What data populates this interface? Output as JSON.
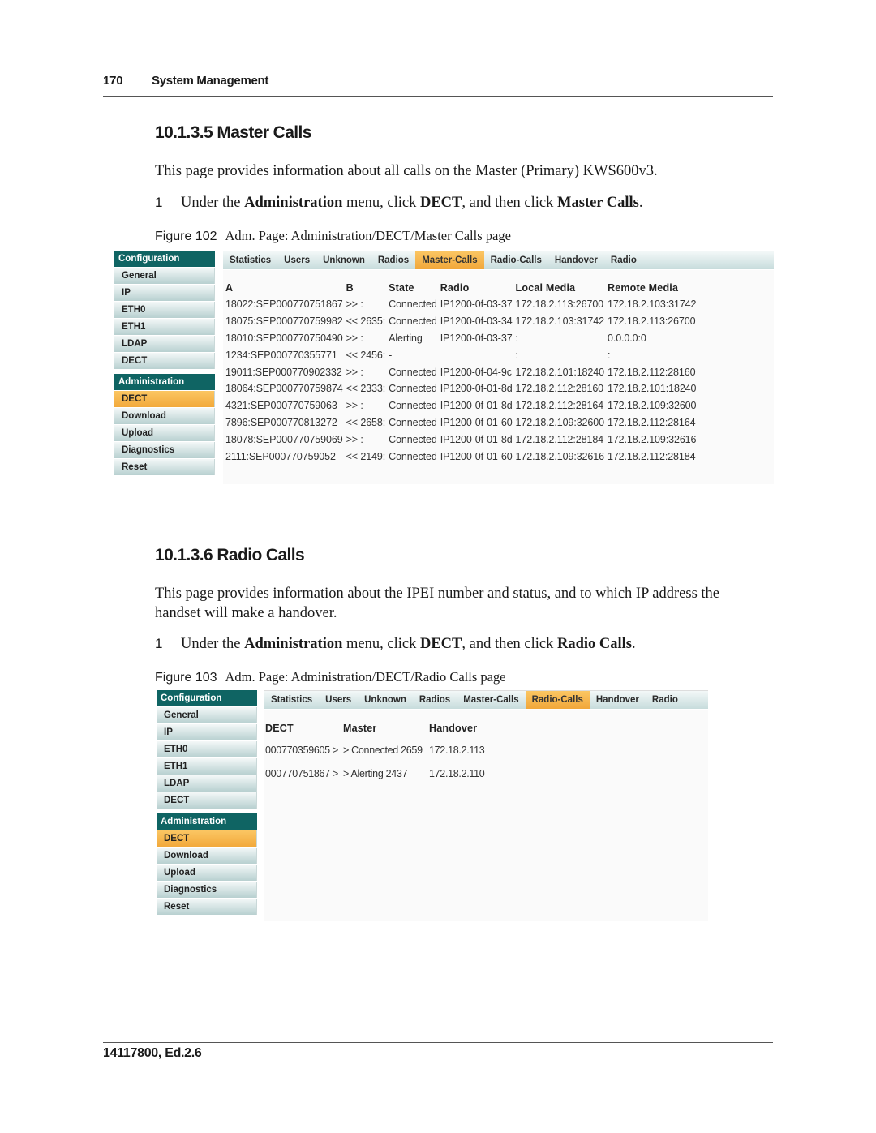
{
  "header": {
    "page_number": "170",
    "section_title": "System Management"
  },
  "footer": {
    "doc_id": "14117800, Ed.2.6"
  },
  "sections": [
    {
      "heading": "10.1.3.5  Master Calls",
      "intro": "This page provides information about all calls on the Master (Primary) KWS600v3.",
      "step": {
        "number": "1",
        "pre": "Under the ",
        "b1": "Administration",
        "mid1": " menu, click ",
        "b2": "DECT",
        "mid2": ", and then click ",
        "b3": "Master Calls",
        "post": "."
      },
      "figure": {
        "label": "Figure 102",
        "caption": "Adm. Page: Administration/DECT/Master Calls page"
      }
    },
    {
      "heading": "10.1.3.6  Radio Calls",
      "intro": "This page provides information about the IPEI number and status, and to which IP address the handset will make a handover.",
      "step": {
        "number": "1",
        "pre": "Under the ",
        "b1": "Administration",
        "mid1": " menu, click ",
        "b2": "DECT",
        "mid2": ", and then click ",
        "b3": "Radio Calls",
        "post": "."
      },
      "figure": {
        "label": "Figure 103",
        "caption": "Adm. Page: Administration/DECT/Radio Calls page"
      }
    }
  ],
  "sidebar": {
    "config_header": "Configuration",
    "config_items": [
      "General",
      "IP",
      "ETH0",
      "ETH1",
      "LDAP",
      "DECT"
    ],
    "admin_header": "Administration",
    "admin_items": [
      "DECT",
      "Download",
      "Upload",
      "Diagnostics",
      "Reset"
    ],
    "active_admin_item": "DECT"
  },
  "tabs": [
    "Statistics",
    "Users",
    "Unknown",
    "Radios",
    "Master-Calls",
    "Radio-Calls",
    "Handover",
    "Radio"
  ],
  "master_calls": {
    "active_tab": "Master-Calls",
    "columns": [
      "A",
      "B",
      "State",
      "Radio",
      "Local Media",
      "Remote Media"
    ],
    "rows": [
      [
        "18022:SEP000770751867",
        ">> :",
        "Connected",
        "IP1200-0f-03-37",
        "172.18.2.113:26700",
        "172.18.2.103:31742"
      ],
      [
        "18075:SEP000770759982",
        "<< 2635:",
        "Connected",
        "IP1200-0f-03-34",
        "172.18.2.103:31742",
        "172.18.2.113:26700"
      ],
      [
        "18010:SEP000770750490",
        ">> :",
        "Alerting",
        "IP1200-0f-03-37",
        ":",
        "0.0.0.0:0"
      ],
      [
        "1234:SEP000770355771",
        "<< 2456:",
        "-",
        "",
        ":",
        ":"
      ],
      [
        "19011:SEP000770902332",
        ">> :",
        "Connected",
        "IP1200-0f-04-9c",
        "172.18.2.101:18240",
        "172.18.2.112:28160"
      ],
      [
        "18064:SEP000770759874",
        "<< 2333:",
        "Connected",
        "IP1200-0f-01-8d",
        "172.18.2.112:28160",
        "172.18.2.101:18240"
      ],
      [
        "4321:SEP000770759063",
        ">> :",
        "Connected",
        "IP1200-0f-01-8d",
        "172.18.2.112:28164",
        "172.18.2.109:32600"
      ],
      [
        "7896:SEP000770813272",
        "<< 2658:",
        "Connected",
        "IP1200-0f-01-60",
        "172.18.2.109:32600",
        "172.18.2.112:28164"
      ],
      [
        "18078:SEP000770759069",
        ">> :",
        "Connected",
        "IP1200-0f-01-8d",
        "172.18.2.112:28184",
        "172.18.2.109:32616"
      ],
      [
        "2111:SEP000770759052",
        "<< 2149:",
        "Connected",
        "IP1200-0f-01-60",
        "172.18.2.109:32616",
        "172.18.2.112:28184"
      ]
    ]
  },
  "radio_calls": {
    "active_tab": "Radio-Calls",
    "columns": [
      "DECT",
      "Master",
      "Handover"
    ],
    "rows": [
      [
        "000770359605 >",
        "> Connected 2659",
        "172.18.2.113"
      ],
      [
        "000770751867 >",
        "> Alerting 2437",
        "172.18.2.110"
      ]
    ]
  },
  "colors": {
    "sidebar_header": "#0f6463",
    "active_orange": "#f2a93b",
    "tab_bar": "#c7dcdc"
  }
}
